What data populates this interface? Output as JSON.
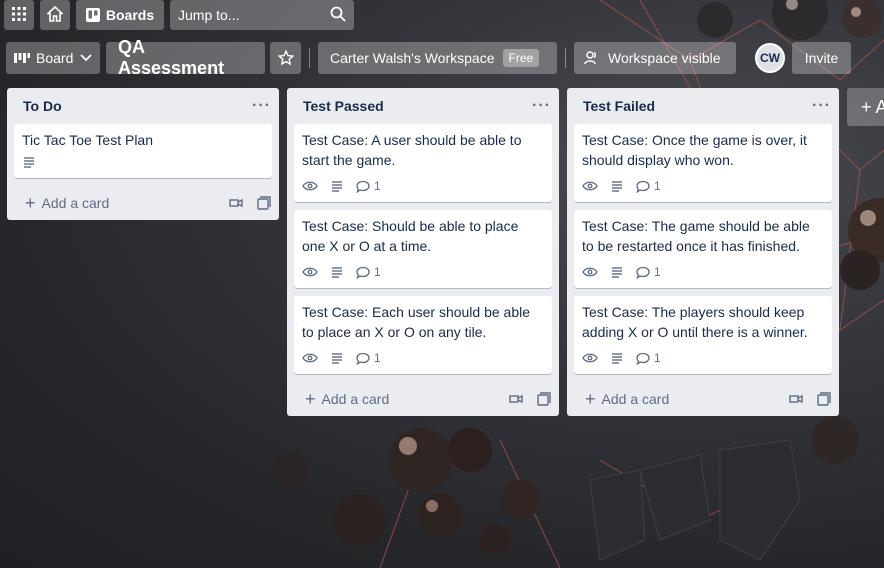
{
  "topnav": {
    "boards_label": "Boards",
    "search_placeholder": "Jump to..."
  },
  "board_header": {
    "view_label": "Board",
    "title": "QA Assessment",
    "workspace_name": "Carter Walsh's Workspace",
    "workspace_plan": "Free",
    "visibility_label": "Workspace visible",
    "avatar_initials": "CW",
    "invite_label": "Invite"
  },
  "lists": [
    {
      "title": "To Do",
      "menu": "···",
      "cards": [
        {
          "title": "Tic Tac Toe Test Plan",
          "has_watch": false,
          "has_description": true,
          "comments": ""
        }
      ],
      "add_label": "Add a card"
    },
    {
      "title": "Test Passed",
      "menu": "···",
      "cards": [
        {
          "title": "Test Case: A user should be able to start the game.",
          "has_watch": true,
          "has_description": true,
          "comments": "1"
        },
        {
          "title": "Test Case: Should be able to place one X or O at a time.",
          "has_watch": true,
          "has_description": true,
          "comments": "1"
        },
        {
          "title": "Test Case: Each user should be able to place an X or O on any tile.",
          "has_watch": true,
          "has_description": true,
          "comments": "1"
        }
      ],
      "add_label": "Add a card"
    },
    {
      "title": "Test Failed",
      "menu": "···",
      "cards": [
        {
          "title": "Test Case: Once the game is over, it should display who won.",
          "has_watch": true,
          "has_description": true,
          "comments": "1"
        },
        {
          "title": "Test Case: The game should be able to be restarted once it has finished.",
          "has_watch": true,
          "has_description": true,
          "comments": "1"
        },
        {
          "title": "Test Case: The players should keep adding X or O until there is a winner.",
          "has_watch": true,
          "has_description": true,
          "comments": "1"
        }
      ],
      "add_label": "Add a card"
    }
  ],
  "add_list": {
    "label": "+ A"
  }
}
